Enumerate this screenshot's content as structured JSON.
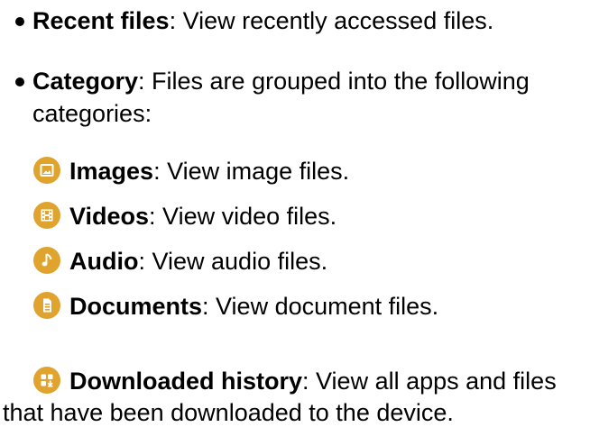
{
  "bullets": [
    {
      "term": "Recent files",
      "desc": ": View recently accessed files."
    },
    {
      "term": "Category",
      "desc": ": Files are grouped into the following",
      "desc2": "categories:"
    }
  ],
  "categories": [
    {
      "icon": "image-icon",
      "term": "Images",
      "desc": ": View image files."
    },
    {
      "icon": "video-icon",
      "term": "Videos",
      "desc": ": View video files."
    },
    {
      "icon": "audio-icon",
      "term": "Audio",
      "desc": ": View audio files."
    },
    {
      "icon": "document-icon",
      "term": "Documents",
      "desc": ": View document files."
    },
    {
      "icon": "download-history-icon",
      "term": "Downloaded history",
      "desc": ": View all apps and files",
      "desc2": "that have been downloaded to the device."
    }
  ],
  "colors": {
    "icon_bg": "#e0a32e",
    "icon_fg": "#ffffff",
    "text": "#000000"
  }
}
